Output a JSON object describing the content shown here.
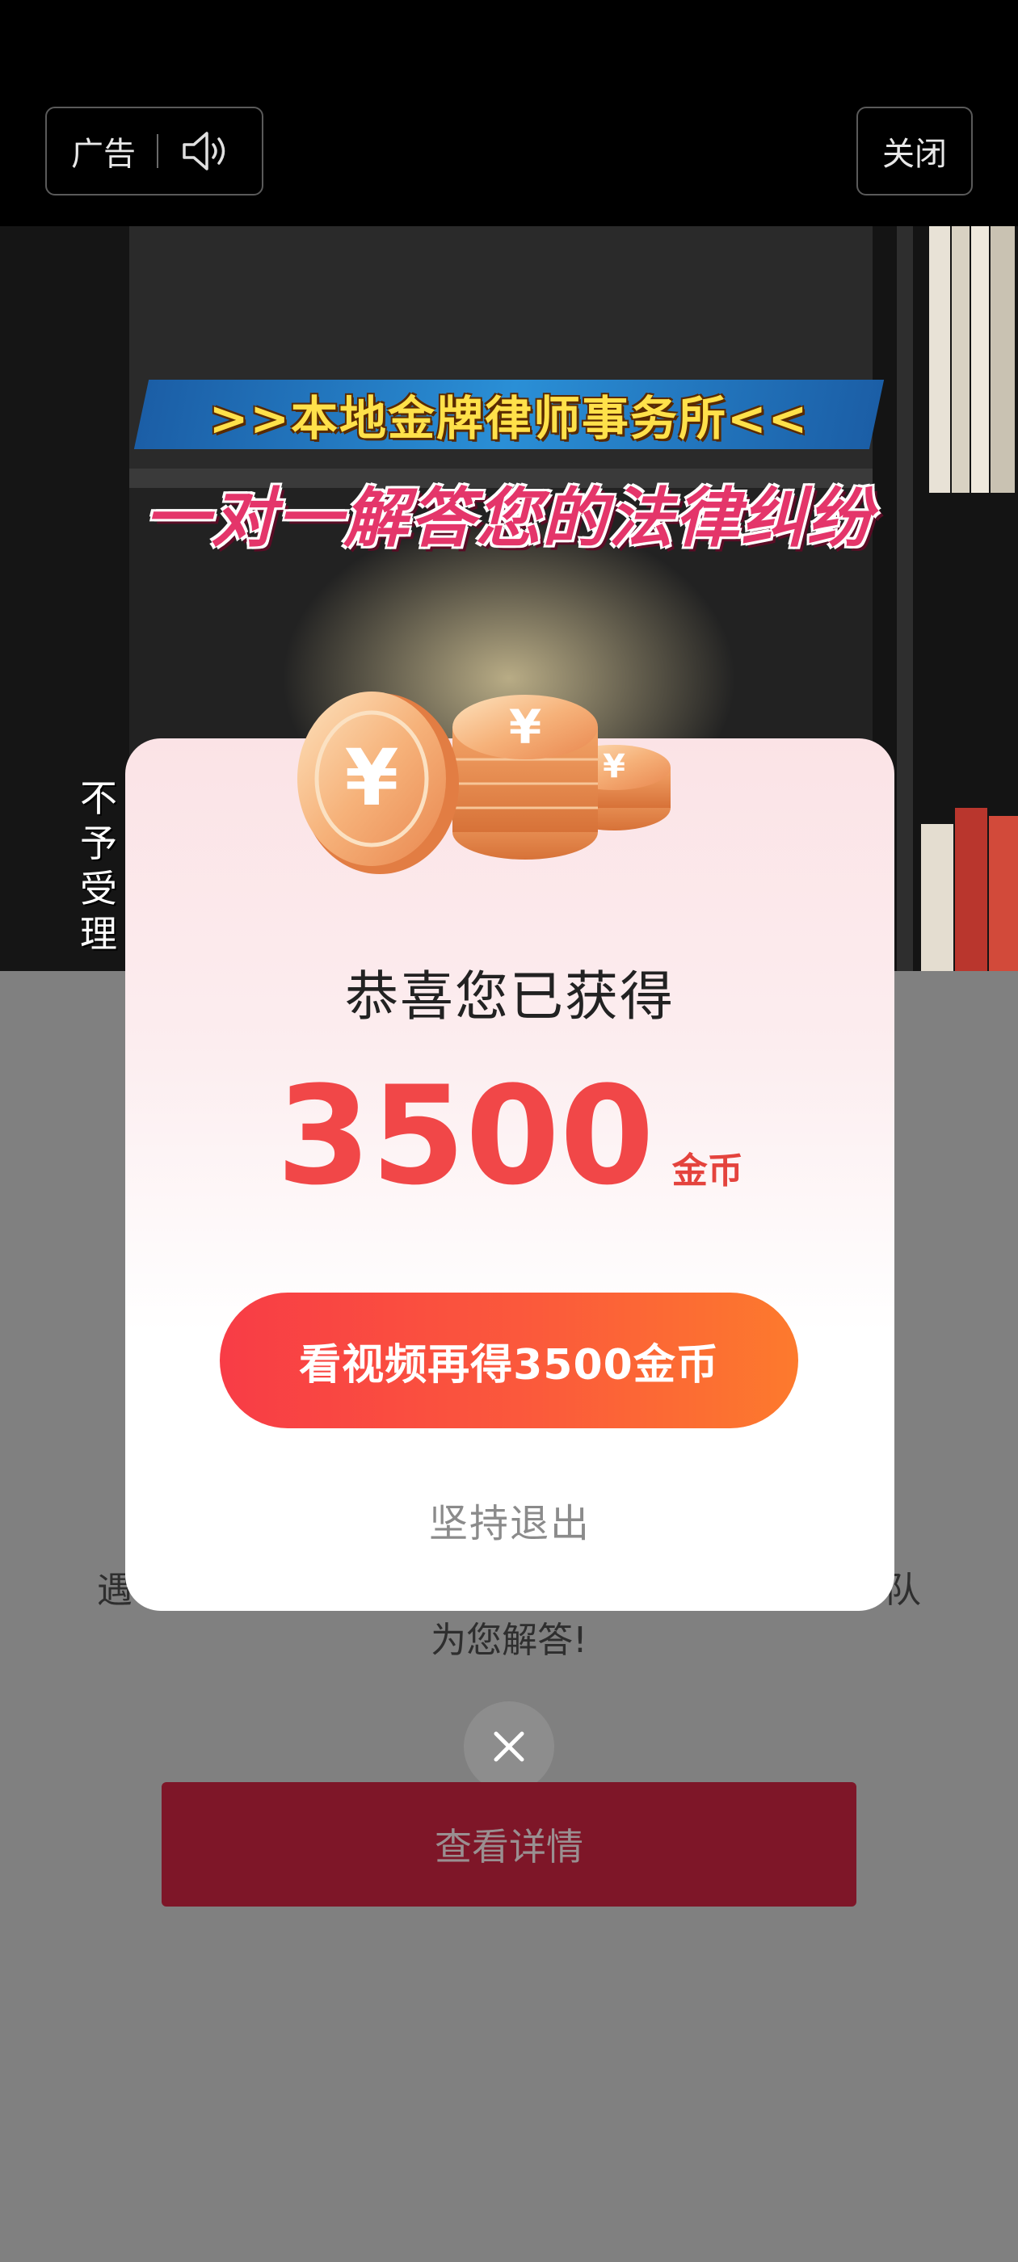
{
  "topbar": {
    "ad_label": "广告",
    "speaker_icon": "speaker-icon",
    "close_label": "关闭"
  },
  "video": {
    "banner_top": ">>本地金牌律师事务所<<",
    "banner_main": "一对一解答您的法律纠纷",
    "side_caption": [
      "不",
      "予",
      "受",
      "理"
    ]
  },
  "page_behind": {
    "desc_line1_start": "遇",
    "desc_line1_end": "队",
    "desc_line2": "为您解答!",
    "cta_label": "查看详情",
    "close_icon": "close-icon"
  },
  "dialog": {
    "title": "恭喜您已获得",
    "amount": "3500",
    "unit": "金币",
    "primary_button": "看视频再得3500金币",
    "exit_link": "坚持退出",
    "coin_icon": "coins-icon"
  }
}
